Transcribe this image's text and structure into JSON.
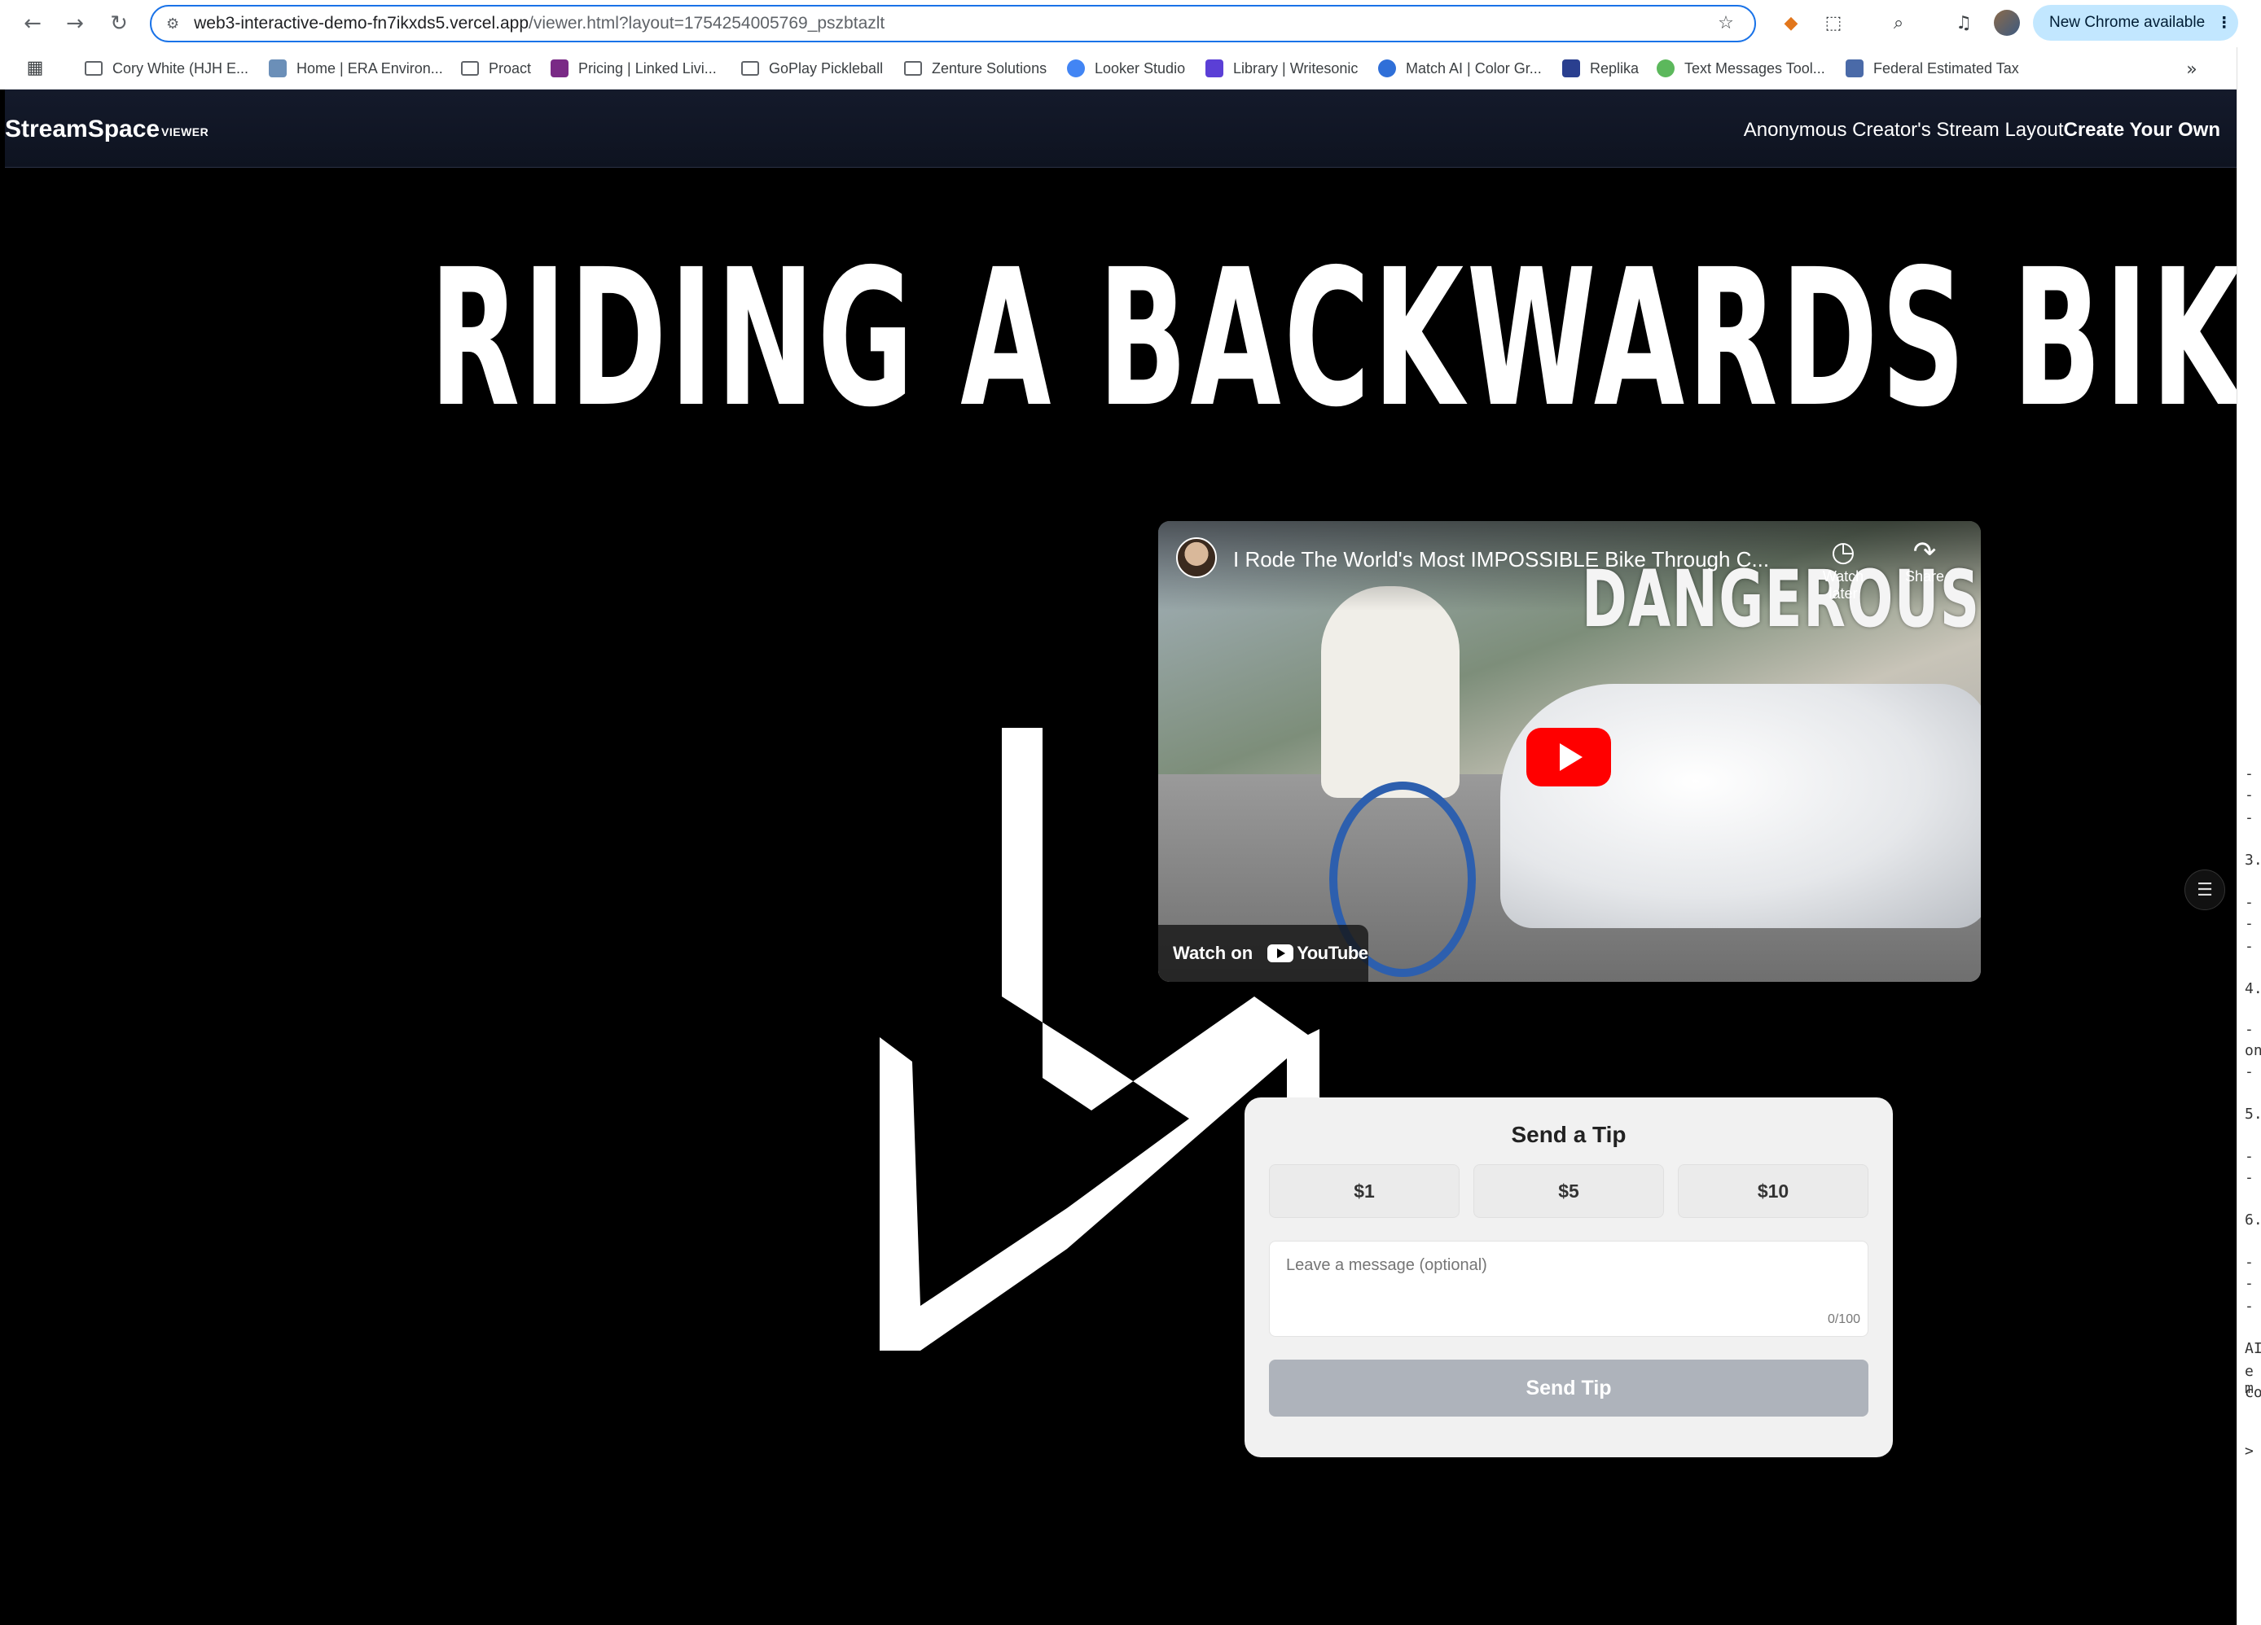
{
  "browser": {
    "url_host": "web3-interactive-demo-fn7ikxds5.vercel.app",
    "url_path": "/viewer.html?layout=1754254005769_pszbtazlt",
    "update_label": "New Chrome available",
    "bookmarks": [
      {
        "label": "Cory White (HJH E...",
        "icon": "folder-icon"
      },
      {
        "label": "Home | ERA Environ...",
        "icon": "era-favicon"
      },
      {
        "label": "Proact",
        "icon": "folder-icon"
      },
      {
        "label": "Pricing | Linked Livi...",
        "icon": "linked-favicon"
      },
      {
        "label": "GoPlay Pickleball",
        "icon": "folder-icon"
      },
      {
        "label": "Zenture Solutions",
        "icon": "folder-icon"
      },
      {
        "label": "Looker Studio",
        "icon": "looker-favicon"
      },
      {
        "label": "Library | Writesonic",
        "icon": "writesonic-favicon"
      },
      {
        "label": "Match AI | Color Gr...",
        "icon": "matchai-favicon"
      },
      {
        "label": "Replika",
        "icon": "replika-favicon"
      },
      {
        "label": "Text Messages Tool...",
        "icon": "text-favicon"
      },
      {
        "label": "Federal Estimated Tax",
        "icon": "tax-favicon"
      }
    ]
  },
  "app": {
    "brand": "StreamSpace",
    "brand_tag": "VIEWER",
    "creator_layout": "Anonymous Creator's Stream Layout",
    "create_cta": "Create Your Own"
  },
  "stage": {
    "title": "RIDING A BACKWARDS BIKE",
    "video": {
      "title": "I Rode The World's Most IMPOSSIBLE Bike Through C...",
      "thumbnail_text": "DANGEROUS",
      "watch_later": "Watch later",
      "share": "Share",
      "watch_on": "Watch on",
      "youtube": "YouTube"
    },
    "tip": {
      "title": "Send a Tip",
      "amounts": [
        "$1",
        "$5",
        "$10"
      ],
      "message_placeholder": "Leave a message (optional)",
      "counter": "0/100",
      "send_label": "Send Tip"
    }
  },
  "colors": {
    "accent": "#1a73e8",
    "header_bg": "#141a2b",
    "youtube_red": "#ff0000",
    "send_disabled": "#aeb3bb"
  },
  "side_panel_glyphs": [
    "-",
    "-",
    "-",
    "3.",
    "-",
    "-",
    "-",
    "4.",
    "-",
    "on",
    "-",
    "5.",
    "-",
    "-",
    "6.",
    "-",
    "-",
    "-",
    "AI",
    "e m",
    "co",
    ">"
  ]
}
